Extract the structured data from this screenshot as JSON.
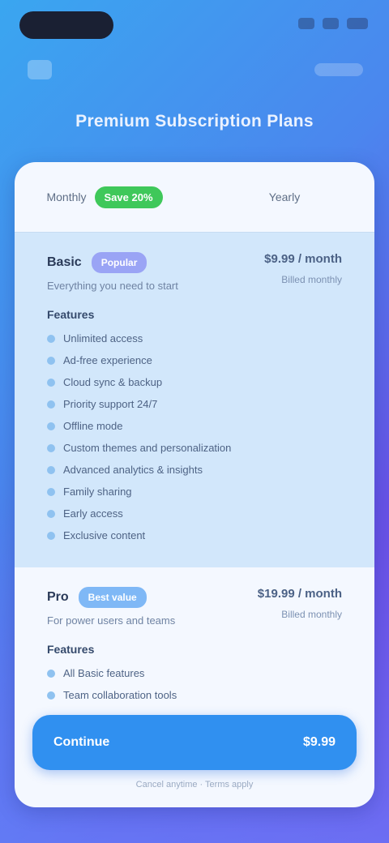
{
  "page": {
    "title": "Premium Subscription Plans"
  },
  "tabs": [
    {
      "label": "Monthly",
      "badge": "Save 20%"
    },
    {
      "label": "Yearly"
    }
  ],
  "plans": [
    {
      "name": "Basic",
      "tag": "Popular",
      "subtitle": "Everything you need to start",
      "price": "$9.99 / month",
      "period": "Billed monthly",
      "features_title": "Features",
      "features": [
        "Unlimited access",
        "Ad-free experience",
        "Cloud sync & backup",
        "Priority support 24/7",
        "Offline mode",
        "Custom themes and personalization",
        "Advanced analytics & insights",
        "Family sharing",
        "Early access",
        "Exclusive content"
      ]
    },
    {
      "name": "Pro",
      "tag": "Best value",
      "subtitle": "For power users and teams",
      "price": "$19.99 / month",
      "period": "Billed monthly",
      "features_title": "Features",
      "features": [
        "All Basic features",
        "Team collaboration tools"
      ]
    }
  ],
  "cta": {
    "label": "Continue",
    "price": "$9.99"
  },
  "note": "Cancel anytime · Terms apply",
  "colors": {
    "accent": "#3090f0",
    "badge": "#3fc85a"
  }
}
